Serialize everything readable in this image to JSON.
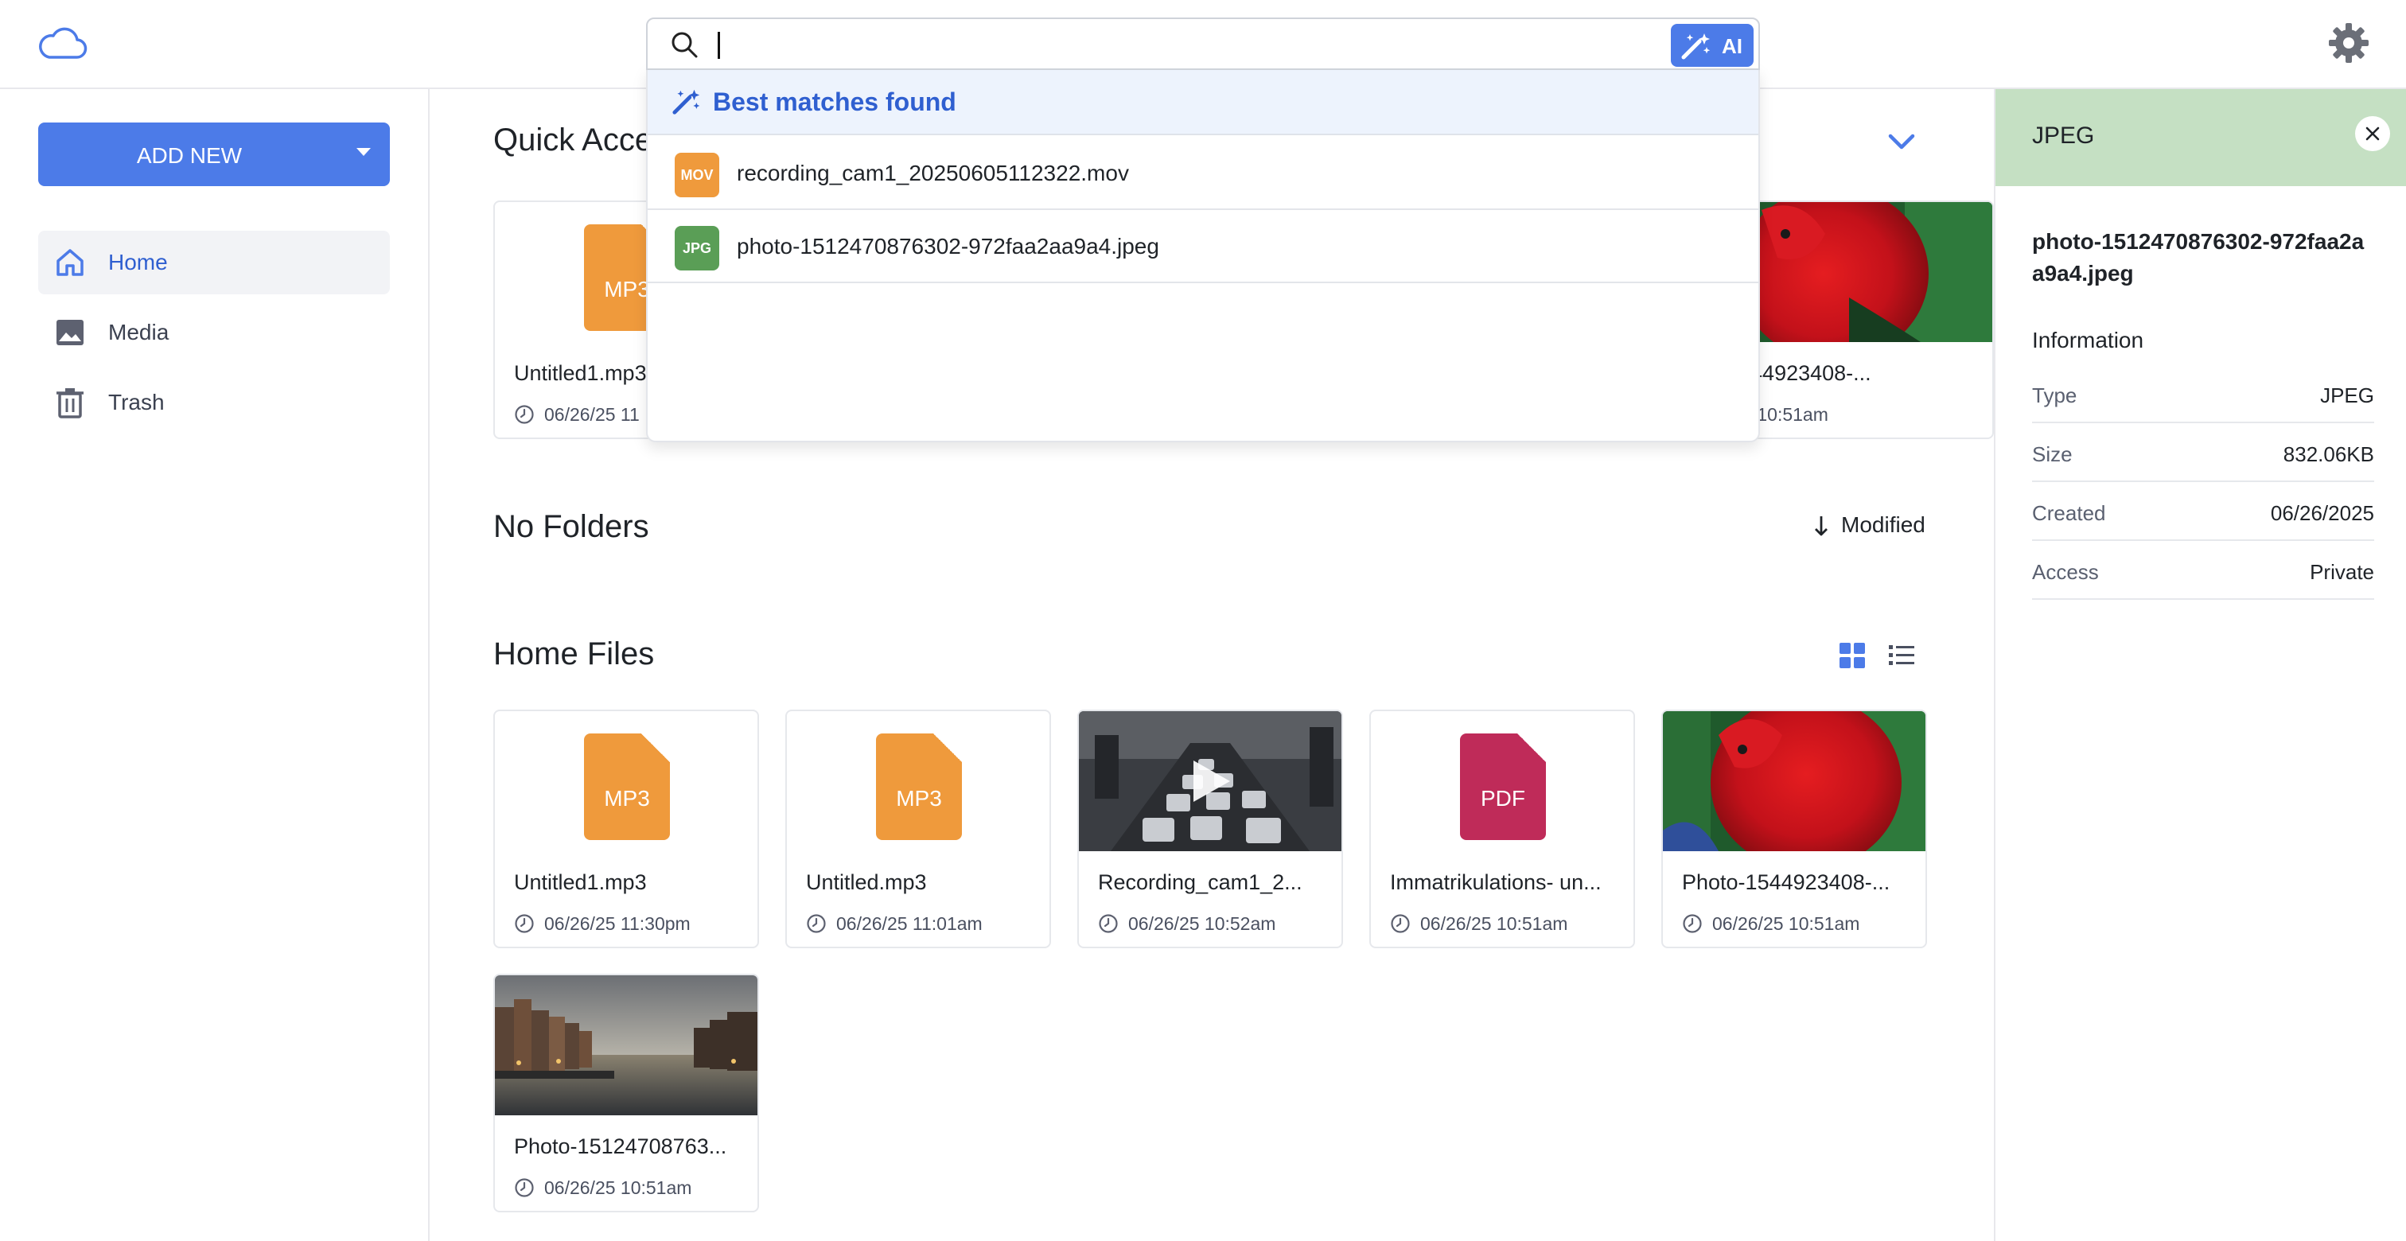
{
  "search": {
    "value": "",
    "ai_label": "AI",
    "results_heading": "Best matches found",
    "results": [
      {
        "badge": "MOV",
        "badge_color": "#ef9a3c",
        "name": "recording_cam1_20250605112322.mov"
      },
      {
        "badge": "JPG",
        "badge_color": "#5a9e56",
        "name": "photo-1512470876302-972faa2aa9a4.jpeg"
      }
    ]
  },
  "sidebar": {
    "add_new_label": "ADD NEW",
    "items": [
      {
        "label": "Home",
        "icon": "home-icon",
        "active": true
      },
      {
        "label": "Media",
        "icon": "image-icon",
        "active": false
      },
      {
        "label": "Trash",
        "icon": "trash-icon",
        "active": false
      }
    ]
  },
  "main": {
    "quick_access": {
      "title": "Quick Acce",
      "items": [
        {
          "name": "Untitled1.mp3",
          "date": "06/26/25 11"
        },
        {
          "name": "1544923408-...",
          "date": "/25 10:51am"
        }
      ]
    },
    "folders": {
      "title": "No Folders",
      "sort_label": "Modified"
    },
    "home_files": {
      "title": "Home Files",
      "files": [
        {
          "name": "Untitled1.mp3",
          "date": "06/26/25 11:30pm",
          "kind": "MP3"
        },
        {
          "name": "Untitled.mp3",
          "date": "06/26/25 11:01am",
          "kind": "MP3"
        },
        {
          "name": "Recording_cam1_2...",
          "date": "06/26/25 10:52am",
          "kind": "video"
        },
        {
          "name": "Immatrikulations- un...",
          "date": "06/26/25 10:51am",
          "kind": "PDF"
        },
        {
          "name": "Photo-1544923408-...",
          "date": "06/26/25 10:51am",
          "kind": "photo-parrot"
        },
        {
          "name": "Photo-15124708763...",
          "date": "06/26/25 10:51am",
          "kind": "photo-canal"
        }
      ]
    }
  },
  "details": {
    "header": "JPEG",
    "file_name": "photo-1512470876302-972faa2aa9a4.jpeg",
    "info_title": "Information",
    "rows": [
      {
        "key": "Type",
        "value": "JPEG"
      },
      {
        "key": "Size",
        "value": "832.06KB"
      },
      {
        "key": "Created",
        "value": "06/26/2025"
      },
      {
        "key": "Access",
        "value": "Private"
      }
    ]
  },
  "colors": {
    "accent": "#4c7be8",
    "mp3": "#ef9a3c",
    "pdf": "#bf2b59",
    "jpeg_header": "#c5e0c3"
  }
}
